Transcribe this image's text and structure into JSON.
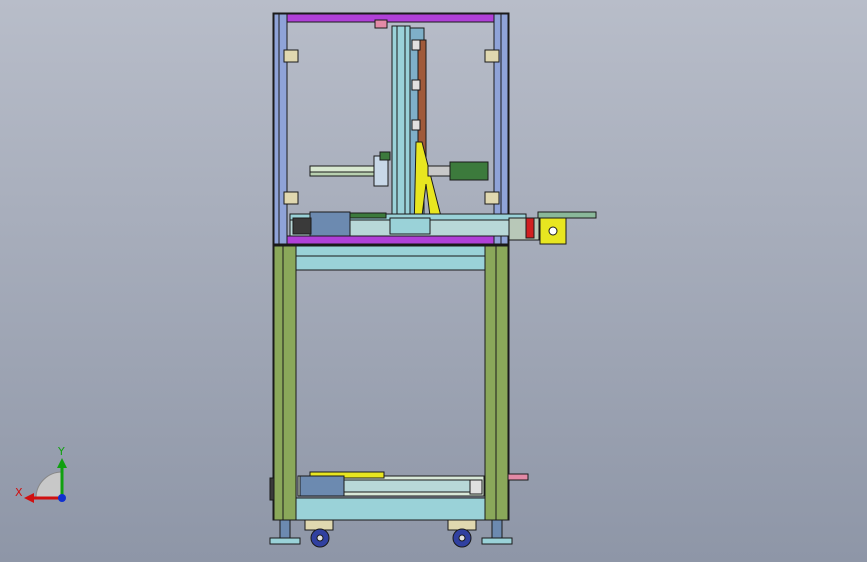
{
  "viewport": {
    "background_top": "#b7bcc8",
    "background_bottom": "#8f97a8"
  },
  "triad": {
    "x_label": "X",
    "y_label": "Y",
    "x_color": "#d01010",
    "y_color": "#10a010",
    "z_color": "#1030d0"
  },
  "colors": {
    "frame_blue": "#8fa3d8",
    "frame_green": "#8aa85a",
    "purple": "#b040d8",
    "cyan": "#9ad2d8",
    "yellow": "#e8e620",
    "dark_green": "#3c7a3c",
    "pink": "#e38aa6"
  }
}
